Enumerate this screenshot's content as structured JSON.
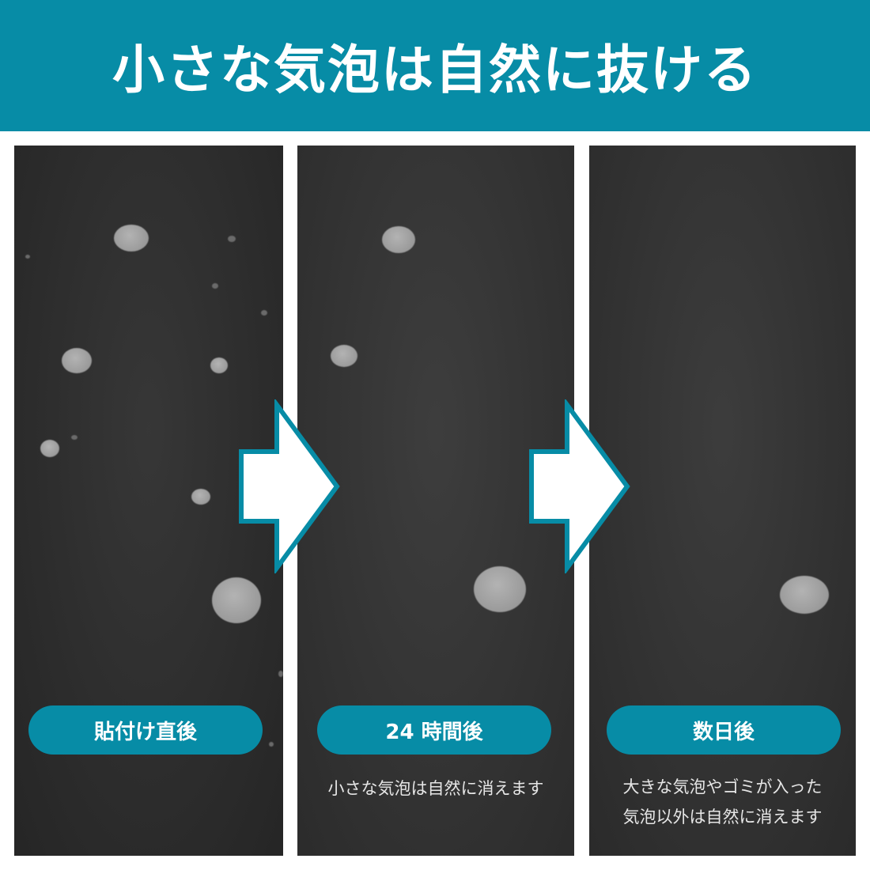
{
  "title": "小さな気泡は自然に抜ける",
  "panels": [
    {
      "label": "貼付け直後",
      "caption": []
    },
    {
      "label": "24 時間後",
      "caption": [
        "小さな気泡は自然に消えます"
      ]
    },
    {
      "label": "数日後",
      "caption": [
        "大きな気泡やゴミが入った",
        "気泡以外は自然に消えます"
      ]
    }
  ],
  "colors": {
    "accent": "#078ca6",
    "panel": "#303030",
    "bubble": "#a6a6a6",
    "arrow_fill": "#ffffff"
  },
  "icons": [
    "right-arrow-icon",
    "right-arrow-icon"
  ]
}
